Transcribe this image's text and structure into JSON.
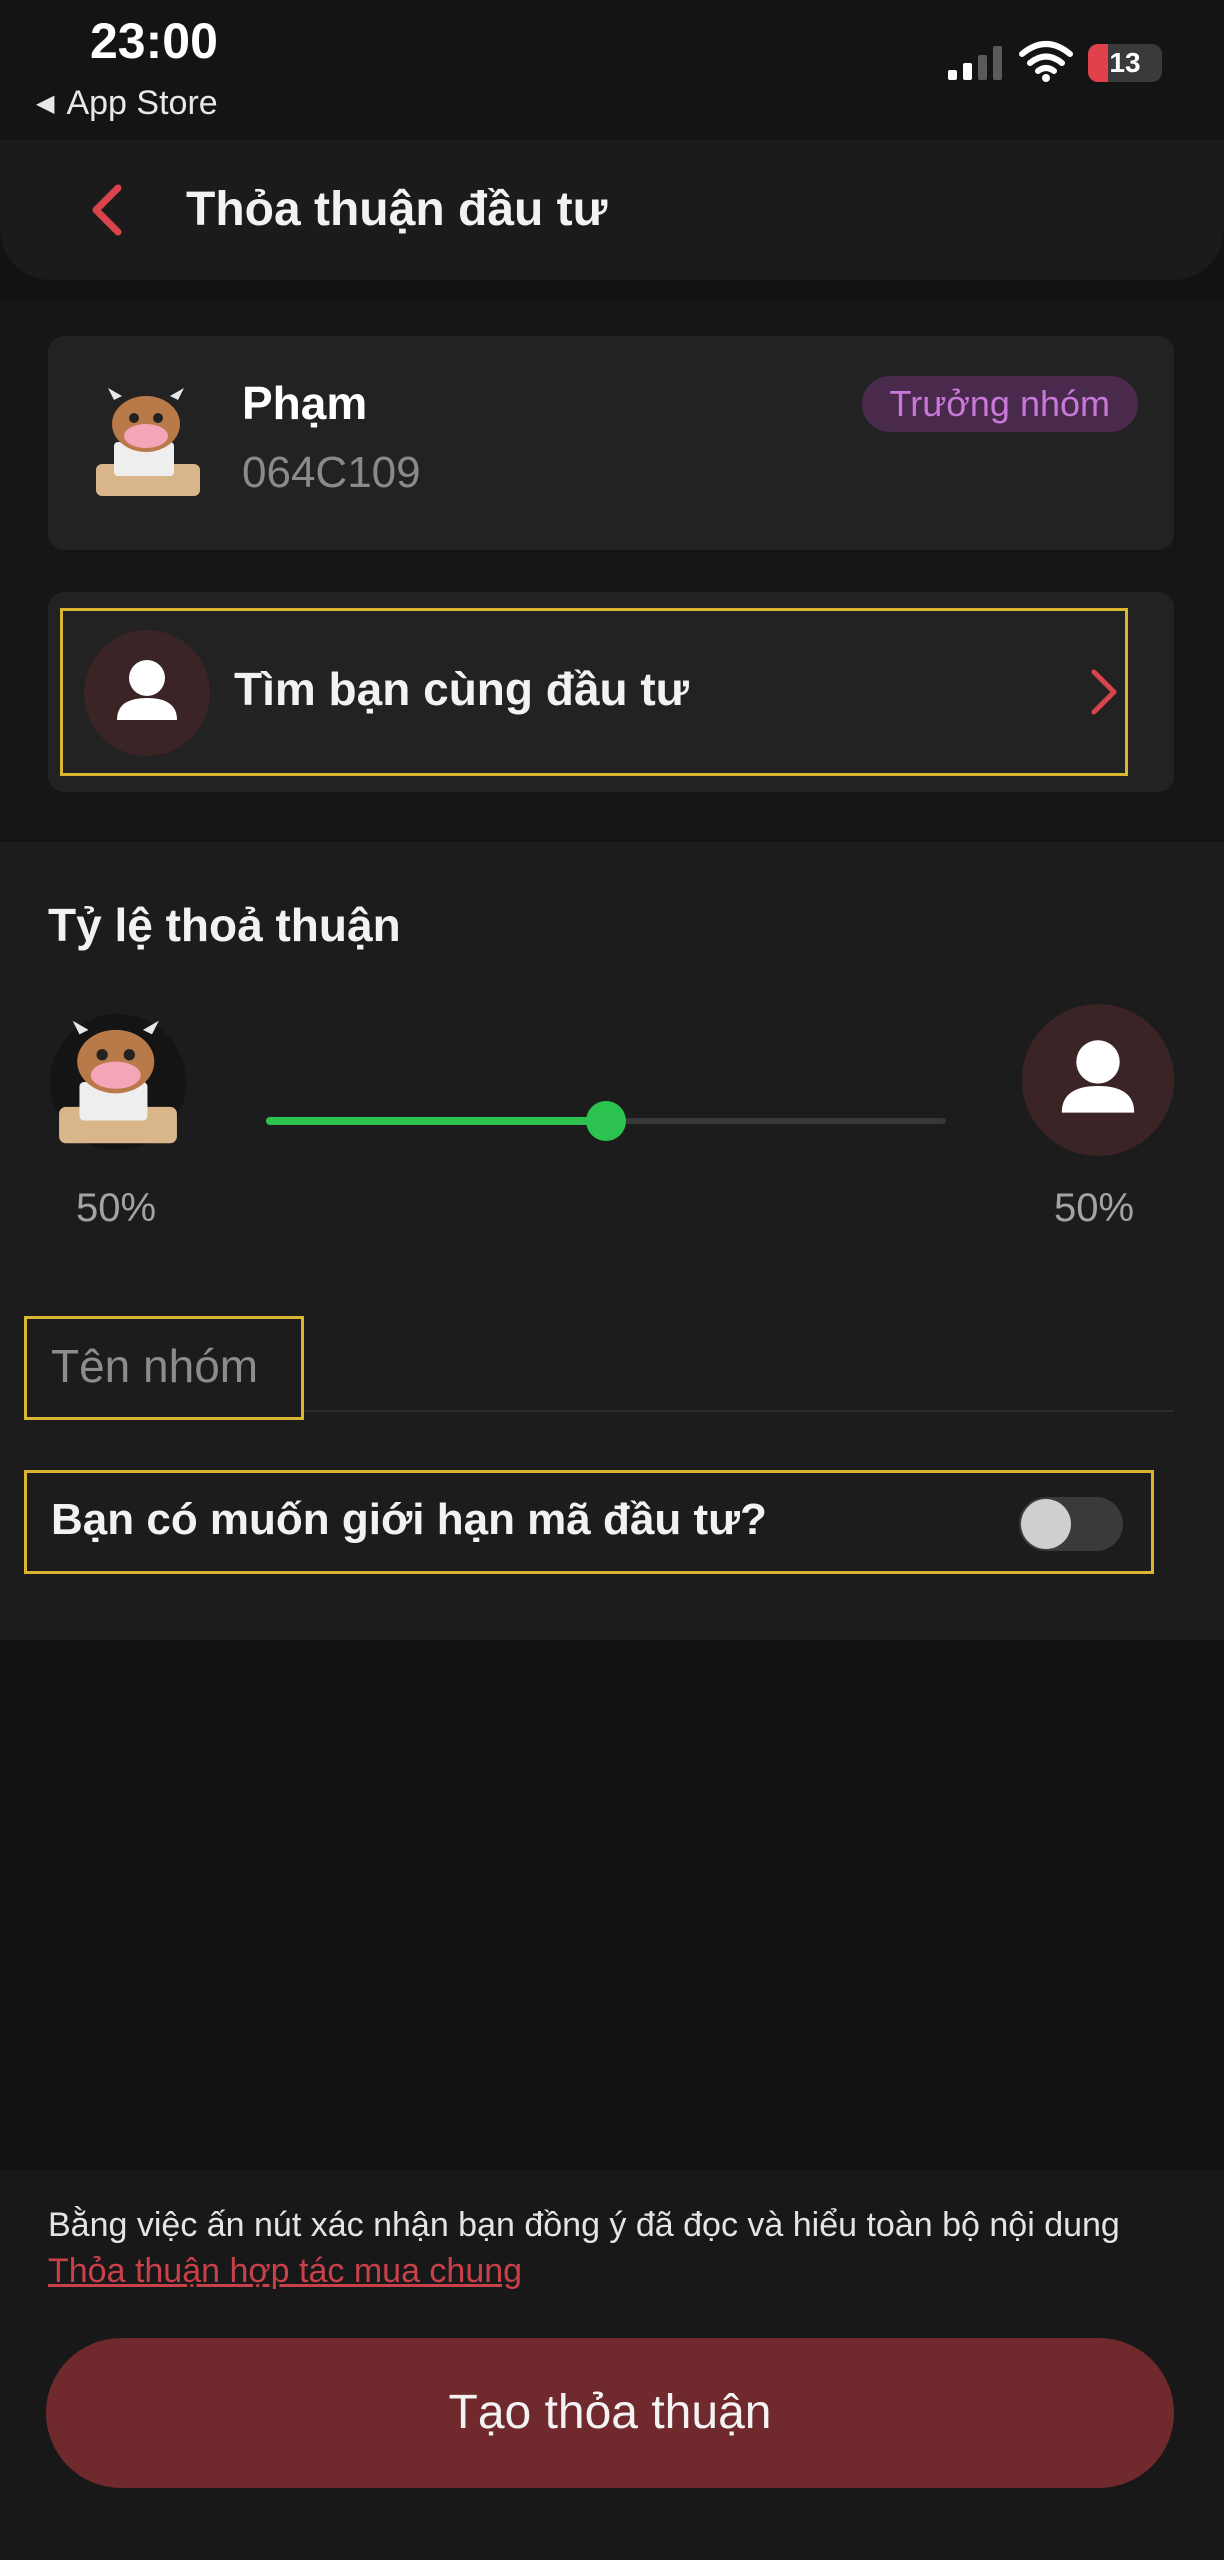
{
  "status_bar": {
    "time": "23:00",
    "back_app": "App Store",
    "battery": "13"
  },
  "header": {
    "title": "Thỏa thuận đầu tư"
  },
  "member": {
    "name": "Phạm",
    "id": "064C109",
    "badge": "Trưởng nhóm"
  },
  "find_partner": {
    "label": "Tìm bạn cùng đầu tư"
  },
  "ratio": {
    "title": "Tỷ lệ thoả thuận",
    "left_percent": "50%",
    "right_percent": "50%",
    "slider_value": 0.5
  },
  "group_name": {
    "placeholder": "Tên nhóm"
  },
  "limit": {
    "label": "Bạn có muốn giới hạn mã đầu tư?",
    "enabled": false
  },
  "footer": {
    "consent_text": "Bằng việc ấn nút xác nhận bạn đồng ý đã đọc và hiểu toàn bộ nội dung ",
    "consent_link": "Thỏa thuận hợp tác mua chung",
    "create_button": "Tạo thỏa thuận"
  },
  "colors": {
    "accent_red": "#c8404a",
    "slider_green": "#2cc24f",
    "badge_purple": "#c878d8",
    "button_bg": "#70292d"
  }
}
